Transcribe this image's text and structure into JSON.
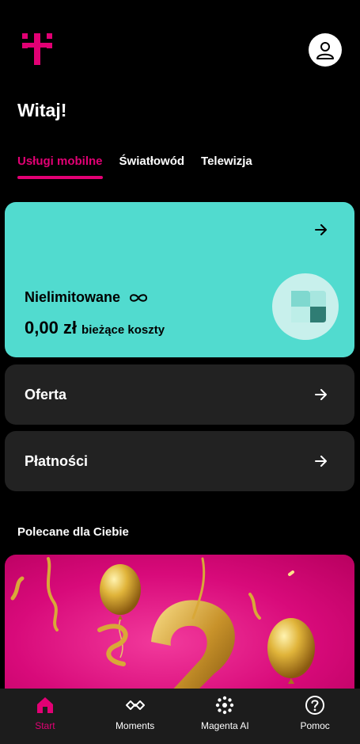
{
  "header": {
    "logo_icon": "telekom-t-logo",
    "profile_icon": "user-icon"
  },
  "greeting": "Witaj!",
  "tabs": [
    {
      "label": "Usługi mobilne",
      "active": true
    },
    {
      "label": "Światłowód",
      "active": false
    },
    {
      "label": "Telewizja",
      "active": false
    }
  ],
  "plan": {
    "name": "Nielimitowane",
    "amount": "0,00 zł",
    "cost_label": "bieżące koszty",
    "infinity_icon": "infinity-icon",
    "arrow_icon": "arrow-right-icon",
    "badge_icon": "plan-badge-icon"
  },
  "rows": [
    {
      "label": "Oferta"
    },
    {
      "label": "Płatności"
    }
  ],
  "recommended_title": "Polecane dla Ciebie",
  "bottom_nav": [
    {
      "label": "Start",
      "icon": "home-icon",
      "active": true
    },
    {
      "label": "Moments",
      "icon": "moments-icon",
      "active": false
    },
    {
      "label": "Magenta AI",
      "icon": "magenta-ai-icon",
      "active": false
    },
    {
      "label": "Pomoc",
      "icon": "help-icon",
      "active": false
    }
  ],
  "colors": {
    "accent": "#e20074",
    "plan_card": "#51dbcf",
    "card_bg": "#222222",
    "background": "#000000"
  }
}
